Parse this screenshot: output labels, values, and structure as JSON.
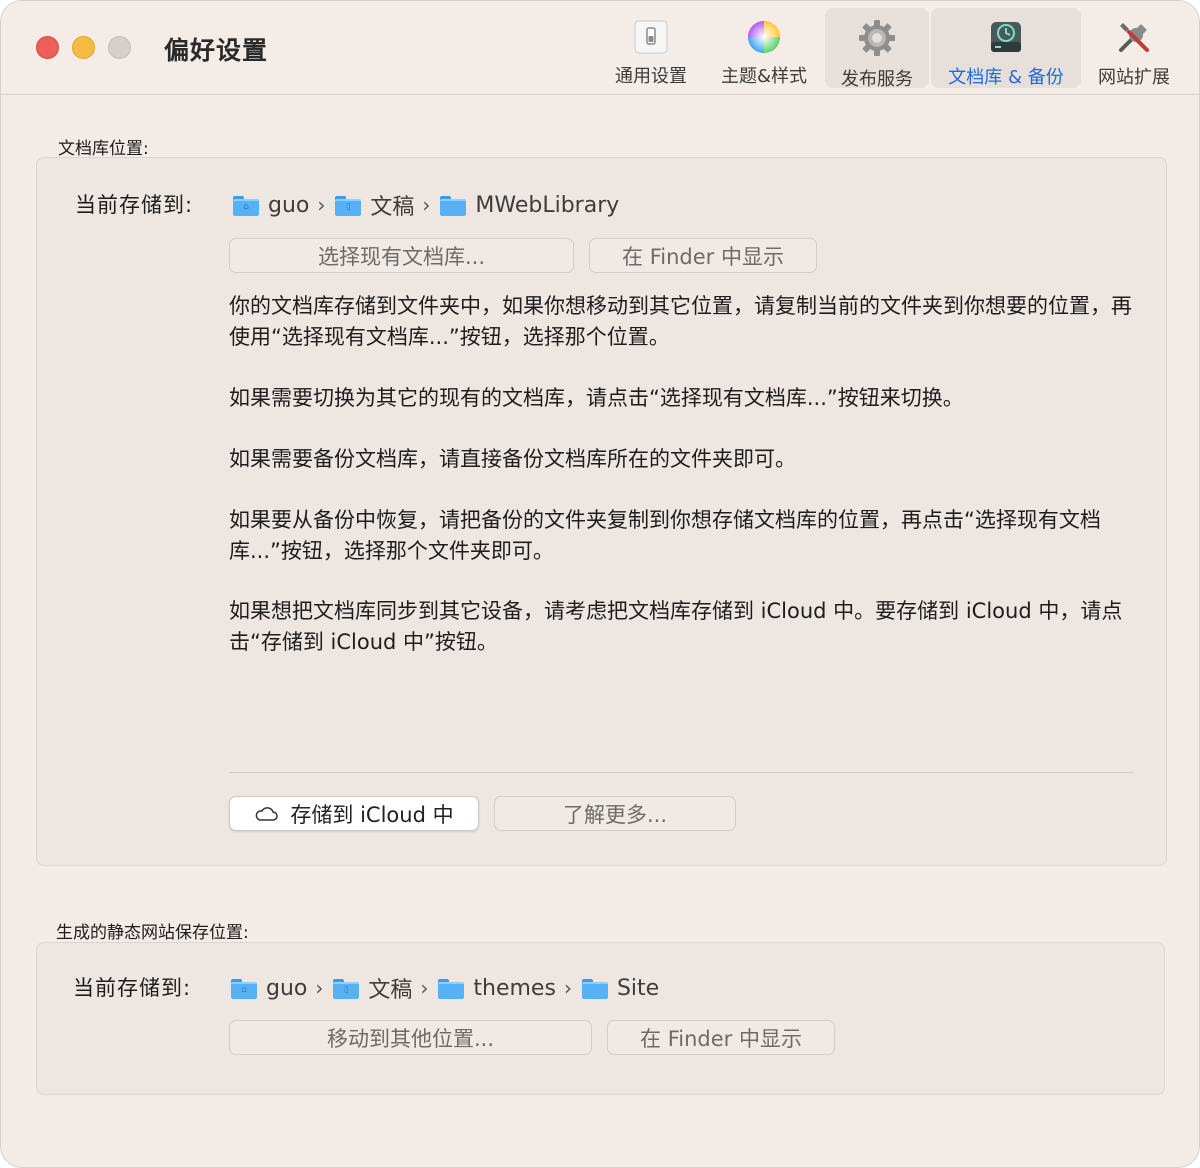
{
  "window": {
    "title": "偏好设置"
  },
  "toolbar": {
    "items": [
      {
        "label": "通用设置",
        "icon": "switch-icon"
      },
      {
        "label": "主题&样式",
        "icon": "color-wheel-icon"
      },
      {
        "label": "发布服务",
        "icon": "gear-icon"
      },
      {
        "label": "文档库 & 备份",
        "icon": "time-machine-disk-icon"
      },
      {
        "label": "网站扩展",
        "icon": "tools-icon"
      }
    ],
    "active_index": 3,
    "active_color": "#1f6ae0"
  },
  "library": {
    "section_label": "文档库位置:",
    "current_label": "当前存储到:",
    "path": [
      {
        "name": "guo",
        "icon": "home-folder-icon"
      },
      {
        "name": "文稿",
        "icon": "documents-folder-icon"
      },
      {
        "name": "MWebLibrary",
        "icon": "folder-icon"
      }
    ],
    "choose_button": "选择现有文档库...",
    "finder_button": "在 Finder 中显示",
    "paragraphs": [
      "你的文档库存储到文件夹中，如果你想移动到其它位置，请复制当前的文件夹到你想要的位置，再使用“选择现有文档库...”按钮，选择那个位置。",
      "如果需要切换为其它的现有的文档库，请点击“选择现有文档库...”按钮来切换。",
      "如果需要备份文档库，请直接备份文档库所在的文件夹即可。",
      "如果要从备份中恢复，请把备份的文件夹复制到你想存储文档库的位置，再点击“选择现有文档库...”按钮，选择那个文件夹即可。",
      "如果想把文档库同步到其它设备，请考虑把文档库存储到 iCloud 中。要存储到 iCloud 中，请点击“存储到 iCloud 中”按钮。"
    ],
    "icloud_button": "存储到 iCloud 中",
    "learn_more_button": "了解更多..."
  },
  "site": {
    "section_label": "生成的静态网站保存位置:",
    "current_label": "当前存储到:",
    "path": [
      {
        "name": "guo",
        "icon": "home-folder-icon"
      },
      {
        "name": "文稿",
        "icon": "documents-folder-icon"
      },
      {
        "name": "themes",
        "icon": "folder-icon"
      },
      {
        "name": "Site",
        "icon": "folder-icon"
      }
    ],
    "move_button": "移动到其他位置...",
    "finder_button": "在 Finder 中显示"
  },
  "separator_glyph": "›"
}
